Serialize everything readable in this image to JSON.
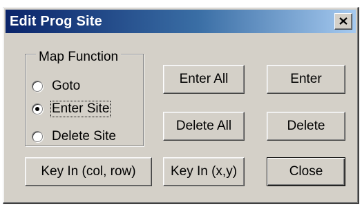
{
  "window": {
    "title": "Edit Prog Site",
    "close_glyph": "✕"
  },
  "map_function": {
    "legend": "Map Function",
    "options": [
      {
        "label": "Goto",
        "selected": false
      },
      {
        "label": "Enter Site",
        "selected": true
      },
      {
        "label": "Delete Site",
        "selected": false
      }
    ]
  },
  "buttons": {
    "enter_all": "Enter All",
    "enter": "Enter",
    "delete_all": "Delete All",
    "delete": "Delete",
    "key_in_col_row": "Key In (col, row)",
    "key_in_xy": "Key In (x,y)",
    "close": "Close"
  },
  "colors": {
    "titlebar_start": "#0a246a",
    "titlebar_end": "#a6caf0",
    "dialog_face": "#d4d0c8"
  }
}
